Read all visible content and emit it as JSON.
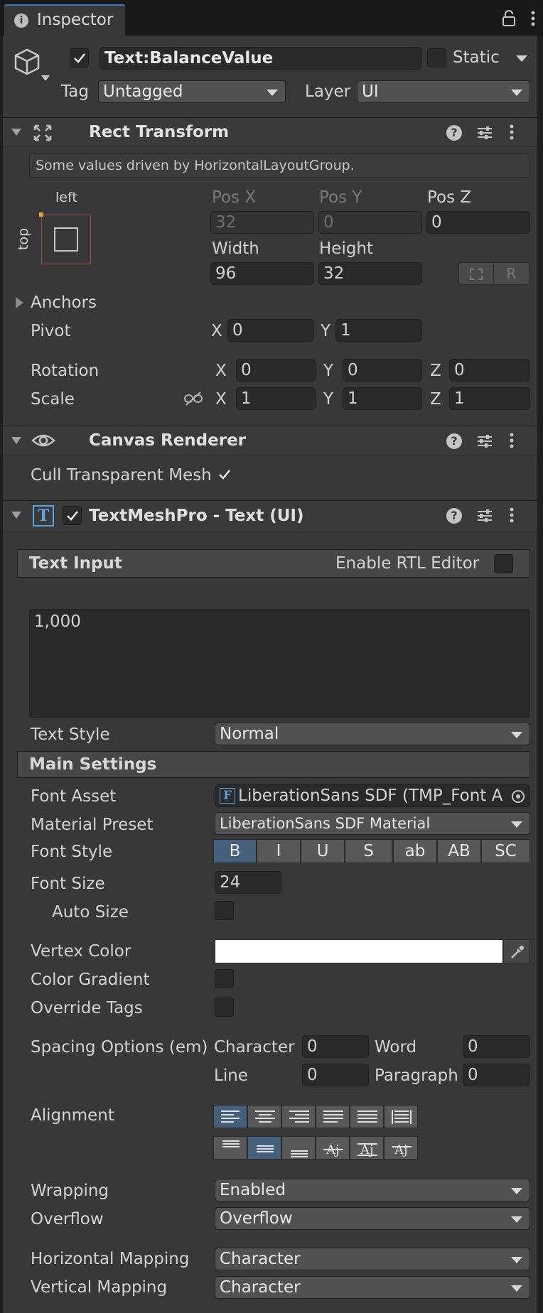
{
  "tab": {
    "title": "Inspector"
  },
  "header": {
    "object_name": "Text:BalanceValue",
    "static_label": "Static",
    "tag_label": "Tag",
    "tag_value": "Untagged",
    "layer_label": "Layer",
    "layer_value": "UI"
  },
  "rect_transform": {
    "title": "Rect Transform",
    "info": "Some values driven by HorizontalLayoutGroup.",
    "anchor_left": "left",
    "anchor_top": "top",
    "pos_x_label": "Pos X",
    "pos_x": "32",
    "pos_y_label": "Pos Y",
    "pos_y": "0",
    "pos_z_label": "Pos Z",
    "pos_z": "0",
    "width_label": "Width",
    "width": "96",
    "height_label": "Height",
    "height": "32",
    "anchors_label": "Anchors",
    "pivot_label": "Pivot",
    "pivot_x": "0",
    "pivot_y": "1",
    "rotation_label": "Rotation",
    "rot_x": "0",
    "rot_y": "0",
    "rot_z": "0",
    "scale_label": "Scale",
    "scale_x": "1",
    "scale_y": "1",
    "scale_z": "1",
    "x": "X",
    "y": "Y",
    "z": "Z"
  },
  "canvas_renderer": {
    "title": "Canvas Renderer",
    "cull_label": "Cull Transparent Mesh"
  },
  "tmp": {
    "title": "TextMeshPro - Text (UI)",
    "text_input_label": "Text Input",
    "rtl_label": "Enable RTL Editor",
    "text_value": "1,000",
    "text_style_label": "Text Style",
    "text_style_value": "Normal",
    "main_settings_label": "Main Settings",
    "font_asset_label": "Font Asset",
    "font_asset_value": "LiberationSans SDF (TMP_Font A",
    "material_preset_label": "Material Preset",
    "material_preset_value": "LiberationSans SDF Material",
    "font_style_label": "Font Style",
    "font_style_buttons": [
      "B",
      "I",
      "U",
      "S",
      "ab",
      "AB",
      "SC"
    ],
    "font_size_label": "Font Size",
    "font_size_value": "24",
    "auto_size_label": "Auto Size",
    "vertex_color_label": "Vertex Color",
    "vertex_color": "#ffffff",
    "color_gradient_label": "Color Gradient",
    "override_tags_label": "Override Tags",
    "spacing_label": "Spacing Options (em)",
    "character_label": "Character",
    "character_value": "0",
    "word_label": "Word",
    "word_value": "0",
    "line_label": "Line",
    "line_value": "0",
    "paragraph_label": "Paragraph",
    "paragraph_value": "0",
    "alignment_label": "Alignment",
    "wrapping_label": "Wrapping",
    "wrapping_value": "Enabled",
    "overflow_label": "Overflow",
    "overflow_value": "Overflow",
    "h_mapping_label": "Horizontal Mapping",
    "h_mapping_value": "Character",
    "v_mapping_label": "Vertical Mapping",
    "v_mapping_value": "Character"
  },
  "colors": {
    "accent": "#46607c",
    "panel": "#383838",
    "field": "#2a2a2a"
  }
}
